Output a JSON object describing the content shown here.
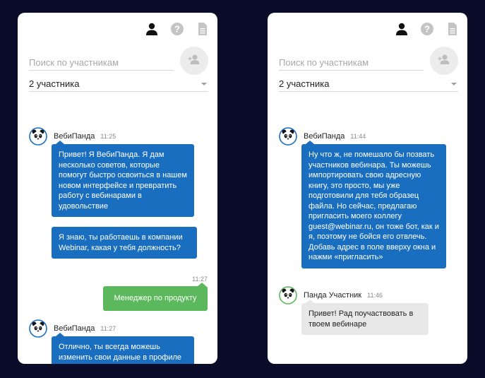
{
  "left": {
    "search_placeholder": "Поиск по участникам",
    "participants_label": "2 участника",
    "messages": [
      {
        "sender": "ВебиПанда",
        "time": "11:25",
        "bubble1": "Привет! Я ВебиПанда. Я дам несколько советов, которые помогут быстро освоиться в нашем новом интерфейсе и превратить работу с вебинарами в удовольствие",
        "bubble2": "Я знаю, ты работаешь в компании Webinar, какая у тебя должность?"
      },
      {
        "time": "11:27",
        "text": "Менеджер по продукту"
      },
      {
        "sender": "ВебиПанда",
        "time": "11:27",
        "bubble1": "Отлично, ты всегда можешь изменить свои данные в профиле"
      }
    ]
  },
  "right": {
    "search_placeholder": "Поиск по участникам",
    "participants_label": "2 участника",
    "messages": [
      {
        "sender": "ВебиПанда",
        "time": "11:44",
        "bubble1": "Ну что ж, не помешало бы позвать участников вебинара. Ты можешь импортировать свою адресную книгу, это просто, мы уже подготовили для тебя образец файла. Но сейчас, предлагаю пригласить моего коллегу guest@webinar.ru, он тоже бот, как и я, поэтому не бойся его отвлечь. Добавь адрес в поле вверху окна и нажми «пригласить»"
      },
      {
        "sender": "Панда Участник",
        "time": "11:46",
        "bubble1": "Привет! Рад поучаствовать в твоем вебинаре"
      }
    ]
  },
  "icons": {
    "user": "person-icon",
    "help": "help-circle-icon",
    "doc": "document-icon",
    "add_user": "add-user-icon",
    "avatar_bot": "panda-avatar-icon",
    "avatar_participant": "panda-green-avatar-icon"
  },
  "colors": {
    "background": "#0b0b2a",
    "bubble_blue": "#1a6ebf",
    "bubble_green": "#5cb85c",
    "bubble_gray": "#e8e8e8"
  }
}
